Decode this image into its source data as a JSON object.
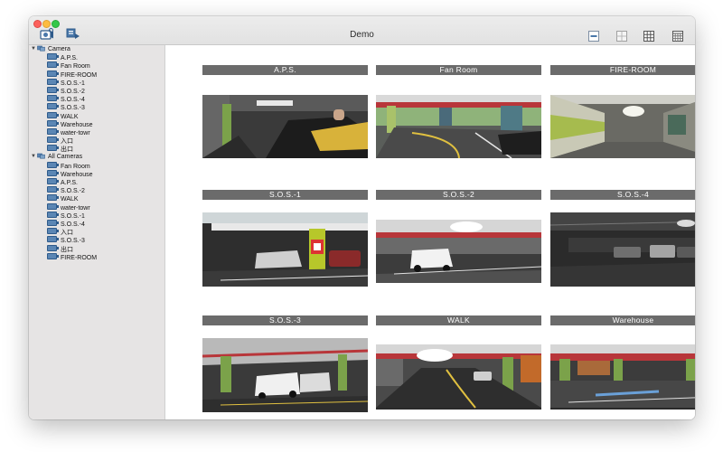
{
  "window": {
    "title": "Demo"
  },
  "toolbar": {
    "left_icons": [
      "camera-settings-icon",
      "device-list-icon"
    ],
    "layout_buttons": [
      "layout-1x1-icon",
      "layout-2x2-icon",
      "layout-3x3-icon",
      "layout-4x4-icon"
    ]
  },
  "sidebar": {
    "groups": [
      {
        "label": "Camera",
        "expanded": true,
        "items": [
          "A.P.S.",
          "Fan Room",
          "FIRE-ROOM",
          "S.O.S.-1",
          "S.O.S.-2",
          "S.O.S.-4",
          "S.O.S.-3",
          "WALK",
          "Warehouse",
          "water-towr",
          "入口",
          "出口"
        ]
      },
      {
        "label": "All Cameras",
        "expanded": true,
        "items": [
          "Fan Room",
          "Warehouse",
          "A.P.S.",
          "S.O.S.-2",
          "WALK",
          "water-towr",
          "S.O.S.-1",
          "S.O.S.-4",
          "入口",
          "S.O.S.-3",
          "出口",
          "FIRE-ROOM"
        ]
      }
    ]
  },
  "grid": {
    "cells": [
      {
        "label": "A.P.S.",
        "scene": "car-closeup"
      },
      {
        "label": "Fan Room",
        "scene": "garage-doors"
      },
      {
        "label": "FIRE-ROOM",
        "scene": "corridor"
      },
      {
        "label": "S.O.S.-1",
        "scene": "pillar-lot"
      },
      {
        "label": "S.O.S.-2",
        "scene": "white-car"
      },
      {
        "label": "S.O.S.-4",
        "scene": "dark-lot"
      },
      {
        "label": "S.O.S.-3",
        "scene": "two-cars"
      },
      {
        "label": "WALK",
        "scene": "ramp"
      },
      {
        "label": "Warehouse",
        "scene": "wide-lot"
      }
    ]
  },
  "colors": {
    "label_bg": "#6b6b6b",
    "sidebar_bg": "#e6e4e4",
    "camera_icon": "#5b86b4"
  }
}
